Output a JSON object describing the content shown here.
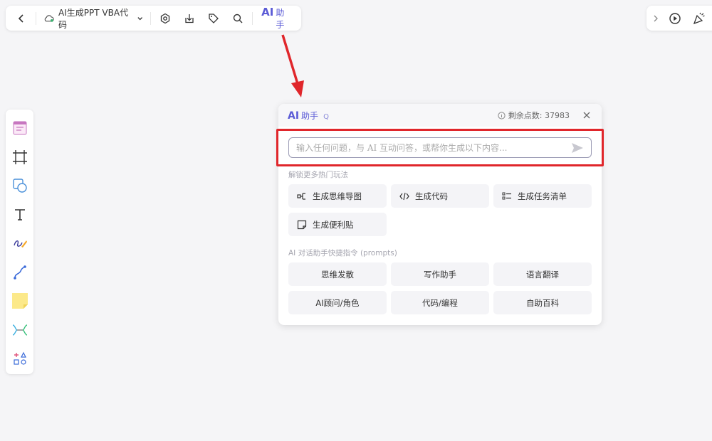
{
  "toolbar": {
    "doc_title": "AI生成PPT VBA代码",
    "ai_label_prefix": "AI",
    "ai_label": "助手"
  },
  "ai_panel": {
    "title_prefix": "AI",
    "title": "助手",
    "title_hint": "Q",
    "points_label": "剩余点数: 37983",
    "input_placeholder": "输入任何问题，与 AI 互动问答，或帮你生成以下内容...",
    "section_play": "解锁更多热门玩法",
    "play_items": [
      {
        "label": "生成思维导图",
        "icon": "mindmap-icon"
      },
      {
        "label": "生成代码",
        "icon": "code-icon"
      },
      {
        "label": "生成任务清单",
        "icon": "checklist-icon"
      },
      {
        "label": "生成便利贴",
        "icon": "sticky-note-icon"
      }
    ],
    "section_prompts": "AI 对话助手快捷指令 (prompts)",
    "prompt_items": [
      {
        "label": "思维发散"
      },
      {
        "label": "写作助手"
      },
      {
        "label": "语言翻译"
      },
      {
        "label": "AI顾问/角色"
      },
      {
        "label": "代码/编程"
      },
      {
        "label": "自助百科"
      }
    ]
  },
  "colors": {
    "accent": "#5b5bd6",
    "annotation_red": "#e0262b"
  }
}
